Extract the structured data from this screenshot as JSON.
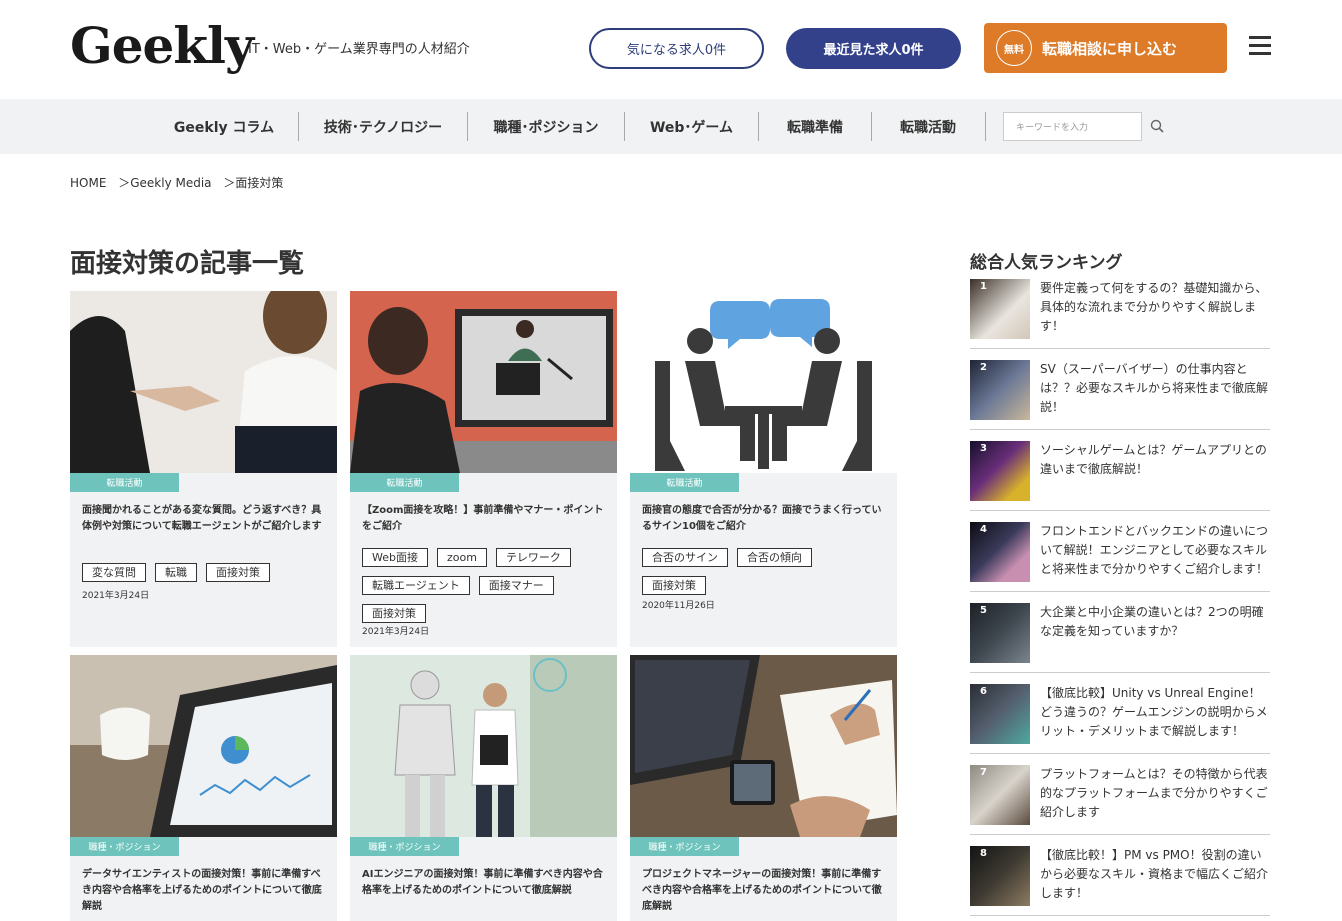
{
  "header": {
    "logo": "Geekly",
    "tagline": "IT・Web・ゲーム業界専門の人材紹介",
    "fav_label": "気になる求人0件",
    "recent_label": "最近見た求人0件",
    "consult_free": "無料",
    "consult_label": "転職相談に申し込む"
  },
  "nav": {
    "items": [
      "Geekly コラム",
      "技術･テクノロジー",
      "職種･ポジション",
      "Web･ゲーム",
      "転職準備",
      "転職活動"
    ],
    "search_placeholder": "キーワードを入力"
  },
  "breadcrumb": [
    "HOME",
    "＞Geekly Media",
    "＞面接対策"
  ],
  "page_title": "面接対策の記事一覧",
  "cards": [
    {
      "category": "転職活動",
      "title": "面接聞かれることがある変な質問。どう返すべき？具体例や対策について転職エージェントがご紹介します",
      "tags": [
        "変な質問",
        "転職",
        "面接対策"
      ],
      "date": "2021年3月24日"
    },
    {
      "category": "転職活動",
      "title": "【Zoom面接を攻略！】事前準備やマナー・ポイントをご紹介",
      "tags": [
        "Web面接",
        "zoom",
        "テレワーク",
        "転職エージェント",
        "面接マナー",
        "面接対策"
      ],
      "date": "2021年3月24日"
    },
    {
      "category": "転職活動",
      "title": "面接官の態度で合否が分かる？面接でうまく行っているサイン10個をご紹介",
      "tags": [
        "合否のサイン",
        "合否の傾向",
        "面接対策"
      ],
      "date": "2020年11月26日"
    },
    {
      "category": "職種・ポジション",
      "title": "データサイエンティストの面接対策！事前に準備すべき内容や合格率を上げるためのポイントについて徹底解説",
      "tags": [],
      "date": ""
    },
    {
      "category": "職種・ポジション",
      "title": "AIエンジニアの面接対策！事前に準備すべき内容や合格率を上げるためのポイントについて徹底解説",
      "tags": [],
      "date": ""
    },
    {
      "category": "職種・ポジション",
      "title": "プロジェクトマネージャーの面接対策！事前に準備すべき内容や合格率を上げるためのポイントについて徹底解説",
      "tags": [],
      "date": ""
    }
  ],
  "ranking": {
    "title": "総合人気ランキング",
    "items": [
      {
        "num": "1",
        "text": "要件定義って何をするの？基礎知識から、具体的な流れまで分かりやすく解説します！"
      },
      {
        "num": "2",
        "text": "SV（スーパーバイザー）の仕事内容とは？？必要なスキルから将来性まで徹底解説！"
      },
      {
        "num": "3",
        "text": "ソーシャルゲームとは？ゲームアプリとの違いまで徹底解説！"
      },
      {
        "num": "4",
        "text": "フロントエンドとバックエンドの違いについて解説！エンジニアとして必要なスキルと将来性まで分かりやすくご紹介します！"
      },
      {
        "num": "5",
        "text": "大企業と中小企業の違いとは？2つの明確な定義を知っていますか？"
      },
      {
        "num": "6",
        "text": "【徹底比較】Unity vs Unreal Engine！どう違うの？ゲームエンジンの説明からメリット・デメリットまで解説します！"
      },
      {
        "num": "7",
        "text": "プラットフォームとは？その特徴から代表的なプラットフォームまで分かりやすくご紹介します"
      },
      {
        "num": "8",
        "text": "【徹底比較！】PM vs PMO！役割の違いから必要なスキル・資格まで幅広くご紹介します！"
      }
    ]
  }
}
